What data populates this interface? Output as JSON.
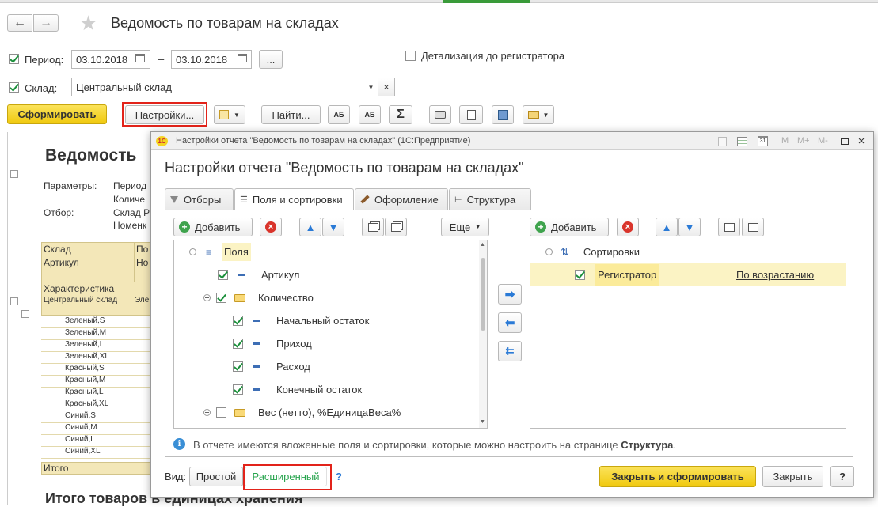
{
  "window": {
    "title": "Ведомость по товарам на складах",
    "nav_back": "←",
    "nav_forward": "→",
    "star": "★"
  },
  "params": {
    "period_label": "Период:",
    "date_from": "03.10.2018",
    "date_to": "03.10.2018",
    "dash": "–",
    "more_btn": "...",
    "detail_label": "Детализация до регистратора",
    "warehouse_label": "Склад:",
    "warehouse_value": "Центральный склад"
  },
  "toolbar": {
    "generate": "Сформировать",
    "settings": "Настройки...",
    "find": "Найти..."
  },
  "report": {
    "title": "Ведомость",
    "params_label": "Параметры:",
    "params_values": [
      "Период",
      "Количе"
    ],
    "filter_label": "Отбор:",
    "filter_values": [
      "Склад Р",
      "Номенк"
    ],
    "header_cells": [
      "Склад",
      "По",
      "Артикул",
      "Но",
      "Характеристика",
      "Центральный склад",
      "Эле"
    ],
    "rows": [
      "Зеленый,S",
      "Зеленый,M",
      "Зеленый,L",
      "Зеленый,XL",
      "Красный,S",
      "Красный,M",
      "Красный,L",
      "Красный,XL",
      "Синий,S",
      "Синий,M",
      "Синий,L",
      "Синий,XL"
    ],
    "total": "Итого",
    "footer_title": "Итого товаров в единицах хранения"
  },
  "dialog": {
    "window_title": "Настройки отчета \"Ведомость по товарам на складах\" (1С:Предприятие)",
    "heading": "Настройки отчета \"Ведомость по товарам на складах\"",
    "tabs": [
      "Отборы",
      "Поля и сортировки",
      "Оформление",
      "Структура"
    ],
    "left_panel": {
      "add": "Добавить",
      "more": "Еще",
      "root": "Поля",
      "items": [
        {
          "label": "Артикул",
          "checked": true
        },
        {
          "label": "Количество",
          "checked": true
        },
        {
          "label": "Начальный остаток",
          "checked": true
        },
        {
          "label": "Приход",
          "checked": true
        },
        {
          "label": "Расход",
          "checked": true
        },
        {
          "label": "Конечный остаток",
          "checked": true
        },
        {
          "label": "Вес (нетто), %ЕдиницаВеса%",
          "checked": false
        }
      ]
    },
    "right_panel": {
      "add": "Добавить",
      "root": "Сортировки",
      "item": "Регистратор",
      "order": "По возрастанию"
    },
    "info_text": "В отчете имеются вложенные поля и сортировки, которые можно настроить на странице ",
    "info_link": "Структура",
    "info_end": ".",
    "view_label": "Вид:",
    "view_simple": "Простой",
    "view_extended": "Расширенный",
    "help": "?",
    "close_generate": "Закрыть и сформировать",
    "close": "Закрыть",
    "help_btn": "?",
    "title_buttons": [
      "M",
      "M+",
      "M-"
    ]
  },
  "colors": {
    "accent_yellow": "#f5d51f",
    "highlight": "#fbf3c4",
    "red_frame": "#e2231a",
    "green_check": "#1a8f3a"
  }
}
